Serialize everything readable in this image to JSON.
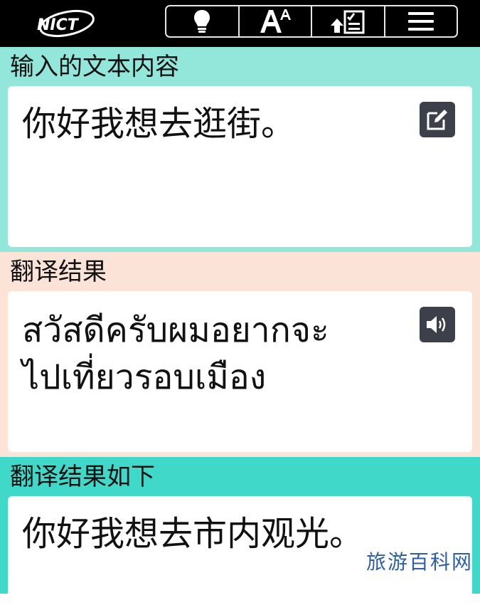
{
  "header": {
    "logo_text": "NICT",
    "toolbar": [
      {
        "icon": "lightbulb-icon"
      },
      {
        "icon": "font-size-icon",
        "glyph": "A",
        "sup": "A"
      },
      {
        "icon": "upload-checklist-icon"
      },
      {
        "icon": "hamburger-menu-icon"
      }
    ]
  },
  "input_section": {
    "label": "输入的文本内容",
    "text": "你好我想去逛街。",
    "action_icon": "edit-icon"
  },
  "result_section": {
    "label": "翻译结果",
    "text_line1": "สวัสดีครับผมอยากจะ",
    "text_line2": "ไปเที่ยวรอบเมือง",
    "action_icon": "speaker-icon"
  },
  "back_section": {
    "label": "翻译结果如下",
    "text": "你好我想去市内观光。"
  },
  "watermark": "旅游百科网",
  "colors": {
    "input_bg": "#93e6da",
    "result_bg": "#fbe3d8",
    "back_bg": "#3fd8c9",
    "icon_bg": "#3d3f4a"
  }
}
